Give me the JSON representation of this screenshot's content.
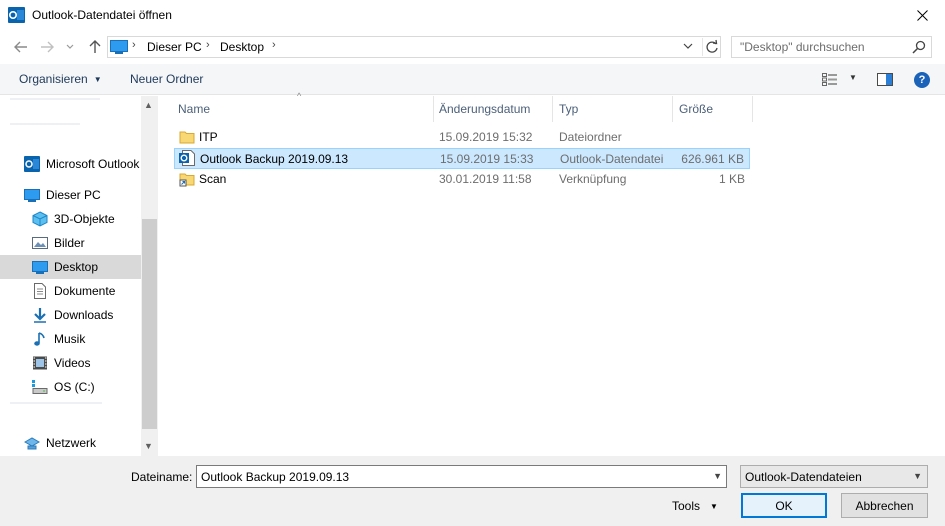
{
  "window": {
    "title": "Outlook-Datendatei öffnen",
    "close_glyph": "✕"
  },
  "address": {
    "crumbs": [
      "Dieser PC",
      "Desktop"
    ],
    "search_placeholder": "\"Desktop\" durchsuchen"
  },
  "toolbar": {
    "organize_label": "Organisieren",
    "new_folder_label": "Neuer Ordner"
  },
  "nav": {
    "items": [
      {
        "label": "Microsoft Outlook",
        "icon": "outlook-icon"
      },
      {
        "label": "Dieser PC",
        "icon": "this-pc-icon"
      },
      {
        "label": "3D-Objekte",
        "icon": "3d-objects-icon"
      },
      {
        "label": "Bilder",
        "icon": "pictures-icon"
      },
      {
        "label": "Desktop",
        "icon": "desktop-icon",
        "selected": true
      },
      {
        "label": "Dokumente",
        "icon": "documents-icon"
      },
      {
        "label": "Downloads",
        "icon": "downloads-icon"
      },
      {
        "label": "Musik",
        "icon": "music-icon"
      },
      {
        "label": "Videos",
        "icon": "videos-icon"
      },
      {
        "label": "OS (C:)",
        "icon": "drive-icon"
      },
      {
        "label": "Netzwerk",
        "icon": "network-icon"
      }
    ]
  },
  "columns": {
    "name": "Name",
    "date": "Änderungsdatum",
    "type": "Typ",
    "size": "Größe"
  },
  "files": [
    {
      "name": "ITP",
      "date": "15.09.2019 15:32",
      "type": "Dateiordner",
      "size": "",
      "icon": "folder-icon"
    },
    {
      "name": "Outlook Backup 2019.09.13",
      "date": "15.09.2019 15:33",
      "type": "Outlook-Datendatei",
      "size": "626.961 KB",
      "icon": "outlook-data-file-icon",
      "selected": true
    },
    {
      "name": "Scan",
      "date": "30.01.2019 11:58",
      "type": "Verknüpfung",
      "size": "1 KB",
      "icon": "folder-shortcut-icon"
    }
  ],
  "bottom": {
    "filename_label": "Dateiname:",
    "filename_value": "Outlook Backup 2019.09.13",
    "filter_value": "Outlook-Datendateien",
    "tools_label": "Tools",
    "ok_label": "OK",
    "cancel_label": "Abbrechen"
  },
  "colors": {
    "accent": "#0078d7",
    "selection_bg": "#cce8ff",
    "selection_border": "#99d1ff",
    "outlook_blue": "#0a64ad",
    "folder_yellow": "#f8d775"
  }
}
